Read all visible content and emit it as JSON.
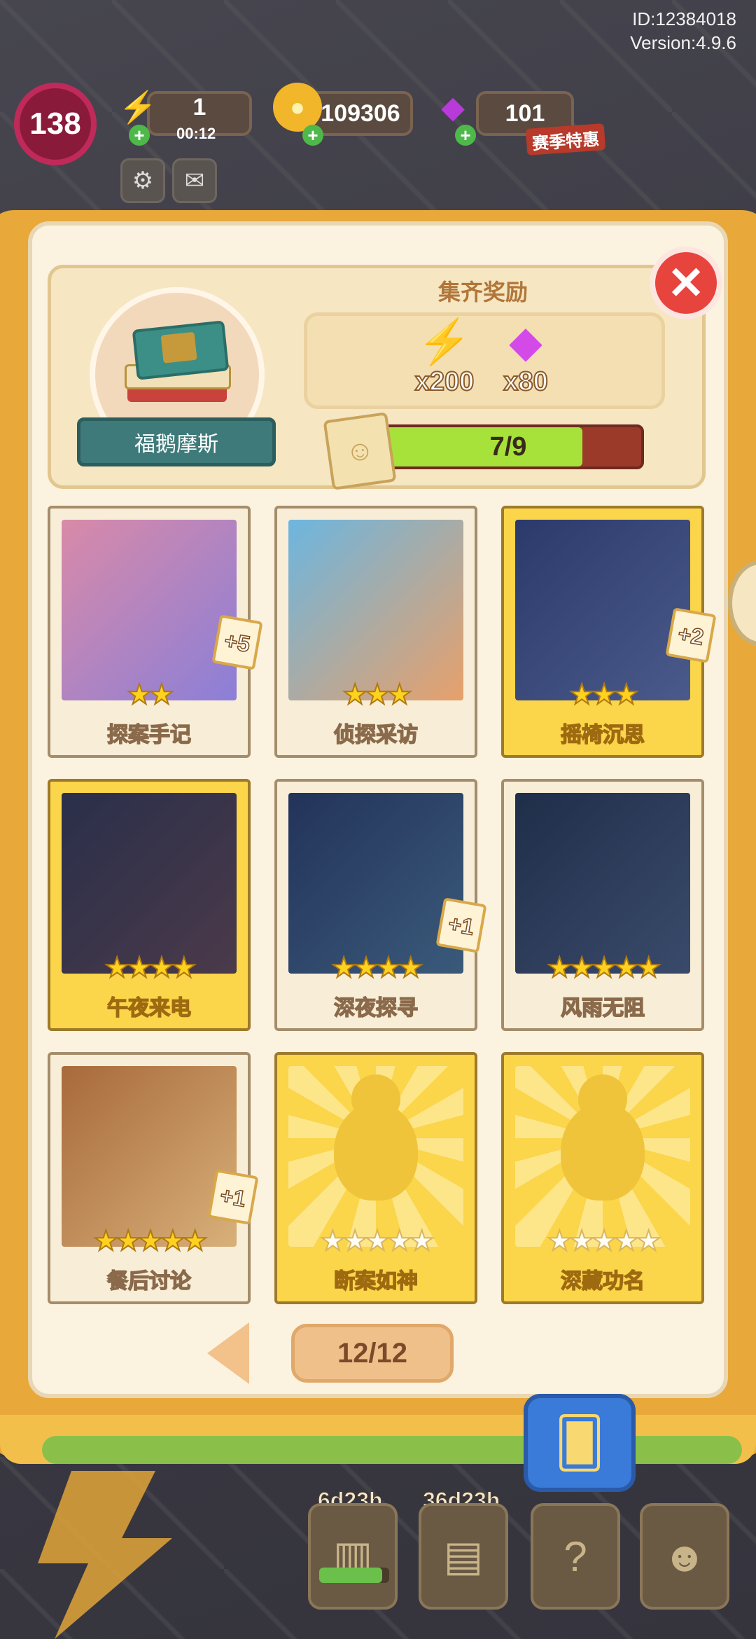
{
  "hud": {
    "id_text": "ID:12384018",
    "version_text": "Version:4.9.6",
    "level": "138",
    "energy": "1",
    "energy_timer": "00:12",
    "coins": "109306",
    "gems": "101",
    "season_label": "赛季特惠",
    "icons": [
      "lightning-icon",
      "coin-icon",
      "gem-icon",
      "settings-icon",
      "mail-icon"
    ]
  },
  "album": {
    "name": "福鹅摩斯",
    "reward_title": "集齐奖励",
    "rewards": [
      {
        "icon": "lightning-icon",
        "qty": "x200"
      },
      {
        "icon": "gem-icon",
        "qty": "x80"
      }
    ],
    "progress_text": "7/9",
    "progress_fraction": 0.778,
    "close_icon": "close-icon"
  },
  "cards": [
    {
      "name": "探案手记",
      "stars": 2,
      "max_stars": 2,
      "gold": false,
      "dup": "+5",
      "owned": true
    },
    {
      "name": "侦探采访",
      "stars": 3,
      "max_stars": 3,
      "gold": false,
      "dup": "",
      "owned": true
    },
    {
      "name": "摇椅沉思",
      "stars": 3,
      "max_stars": 3,
      "gold": true,
      "dup": "+2",
      "owned": true
    },
    {
      "name": "午夜来电",
      "stars": 4,
      "max_stars": 4,
      "gold": true,
      "dup": "",
      "owned": true
    },
    {
      "name": "深夜探寻",
      "stars": 4,
      "max_stars": 4,
      "gold": false,
      "dup": "+1",
      "owned": true
    },
    {
      "name": "风雨无阻",
      "stars": 5,
      "max_stars": 5,
      "gold": false,
      "dup": "",
      "owned": true
    },
    {
      "name": "餐后讨论",
      "stars": 5,
      "max_stars": 5,
      "gold": false,
      "dup": "+1",
      "owned": true
    },
    {
      "name": "断案如神",
      "stars": 0,
      "max_stars": 5,
      "gold": true,
      "dup": "",
      "owned": false
    },
    {
      "name": "深藏功名",
      "stars": 0,
      "max_stars": 5,
      "gold": true,
      "dup": "",
      "owned": false
    }
  ],
  "pager": {
    "page_text": "12/12",
    "prev_icon": "chevron-left-icon"
  },
  "bottom_bar": {
    "timer_1": "6d23h",
    "timer_2": "36d23h",
    "items": [
      "pillar-icon",
      "cards-icon",
      "help-icon",
      "characters-icon"
    ],
    "progress_fraction": 0.9
  },
  "colors": {
    "gold_card": "#fbd54a",
    "progress_fill": "#a6e23a",
    "close_red": "#e8443e",
    "star_yellow": "#ffd21f"
  }
}
